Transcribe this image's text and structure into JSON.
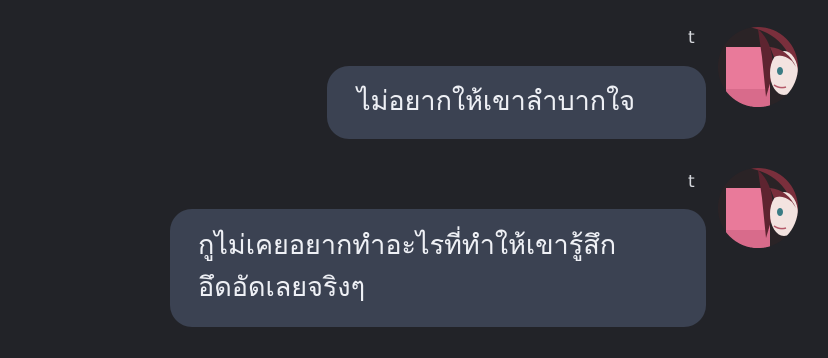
{
  "messages": [
    {
      "sender": "t",
      "lines": [
        "ไม่อยากให้เขาลำบากใจ"
      ],
      "avatar_icon": "anime-avatar-icon"
    },
    {
      "sender": "t",
      "lines": [
        "กูไม่เคยอยากทำอะไรที่ทำให้เขารู้สึก",
        "อึดอัดเลยจริงๆ"
      ],
      "avatar_icon": "anime-avatar-icon"
    }
  ],
  "colors": {
    "background": "#222328",
    "bubble": "#3b4252",
    "text": "#eef0f5",
    "avatar_pink": "#e97a9a",
    "avatar_hair": "#7a2f3c"
  }
}
